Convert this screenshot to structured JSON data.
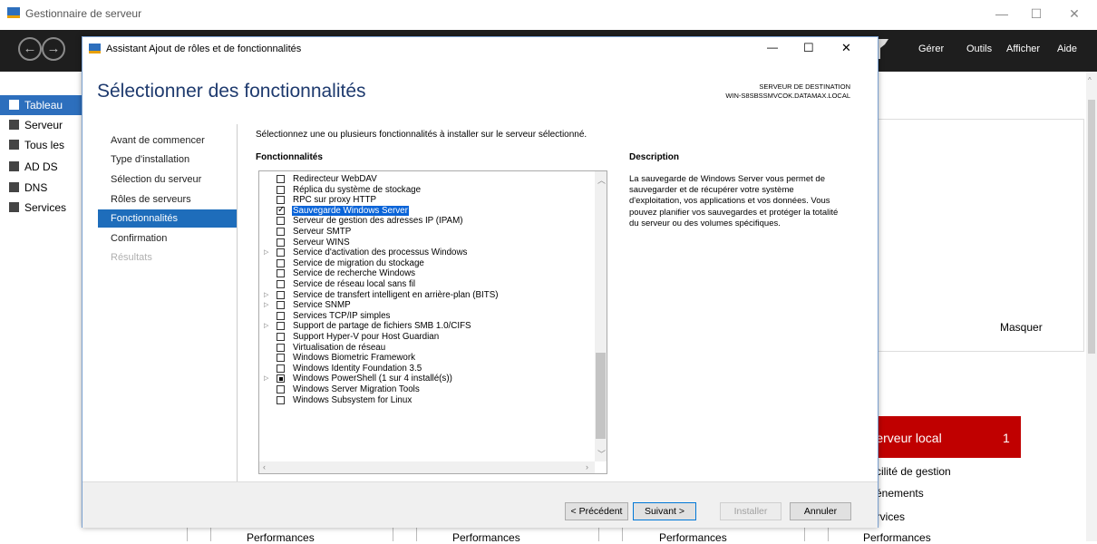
{
  "server_manager": {
    "title": "Gestionnaire de serveur",
    "menu": [
      "Gérer",
      "Outils",
      "Afficher",
      "Aide"
    ],
    "nav": [
      "Tableau",
      "Serveur",
      "Tous les",
      "AD DS",
      "DNS",
      "Services"
    ],
    "hide_label": "Masquer",
    "local_tile": {
      "label": "Serveur local",
      "count": "1",
      "color": "#c00000"
    },
    "tile_lines": [
      "Facilité de gestion",
      "Événements",
      "Services",
      "Performances"
    ],
    "perf_labels": [
      "Performances",
      "Performances",
      "Performances"
    ]
  },
  "wizard": {
    "title": "Assistant Ajout de rôles et de fonctionnalités",
    "heading": "Sélectionner des fonctionnalités",
    "destination_label": "SERVEUR DE DESTINATION",
    "destination_server": "WIN-S8SBSSMVCOK.DATAMAX.LOCAL",
    "steps": [
      {
        "label": "Avant de commencer",
        "state": "normal"
      },
      {
        "label": "Type d'installation",
        "state": "normal"
      },
      {
        "label": "Sélection du serveur",
        "state": "normal"
      },
      {
        "label": "Rôles de serveurs",
        "state": "normal"
      },
      {
        "label": "Fonctionnalités",
        "state": "active"
      },
      {
        "label": "Confirmation",
        "state": "normal"
      },
      {
        "label": "Résultats",
        "state": "disabled"
      }
    ],
    "instruction": "Sélectionnez une ou plusieurs fonctionnalités à installer sur le serveur sélectionné.",
    "features_label": "Fonctionnalités",
    "description_label": "Description",
    "description_text": "La sauvegarde de Windows Server vous permet de sauvegarder et de récupérer votre système d'exploitation, vos applications et vos données. Vous pouvez planifier vos sauvegardes et protéger la totalité du serveur ou des volumes spécifiques.",
    "features": [
      {
        "label": "Redirecteur WebDAV",
        "state": "unchecked",
        "expandable": false,
        "selected": false
      },
      {
        "label": "Réplica du système de stockage",
        "state": "unchecked",
        "expandable": false,
        "selected": false
      },
      {
        "label": "RPC sur proxy HTTP",
        "state": "unchecked",
        "expandable": false,
        "selected": false
      },
      {
        "label": "Sauvegarde Windows Server",
        "state": "checked",
        "expandable": false,
        "selected": true
      },
      {
        "label": "Serveur de gestion des adresses IP (IPAM)",
        "state": "unchecked",
        "expandable": false,
        "selected": false
      },
      {
        "label": "Serveur SMTP",
        "state": "unchecked",
        "expandable": false,
        "selected": false
      },
      {
        "label": "Serveur WINS",
        "state": "unchecked",
        "expandable": false,
        "selected": false
      },
      {
        "label": "Service d'activation des processus Windows",
        "state": "unchecked",
        "expandable": true,
        "selected": false
      },
      {
        "label": "Service de migration du stockage",
        "state": "unchecked",
        "expandable": false,
        "selected": false
      },
      {
        "label": "Service de recherche Windows",
        "state": "unchecked",
        "expandable": false,
        "selected": false
      },
      {
        "label": "Service de réseau local sans fil",
        "state": "unchecked",
        "expandable": false,
        "selected": false
      },
      {
        "label": "Service de transfert intelligent en arrière-plan (BITS)",
        "state": "unchecked",
        "expandable": true,
        "selected": false
      },
      {
        "label": "Service SNMP",
        "state": "unchecked",
        "expandable": true,
        "selected": false
      },
      {
        "label": "Services TCP/IP simples",
        "state": "unchecked",
        "expandable": false,
        "selected": false
      },
      {
        "label": "Support de partage de fichiers SMB 1.0/CIFS",
        "state": "unchecked",
        "expandable": true,
        "selected": false
      },
      {
        "label": "Support Hyper-V pour Host Guardian",
        "state": "unchecked",
        "expandable": false,
        "selected": false
      },
      {
        "label": "Virtualisation de réseau",
        "state": "unchecked",
        "expandable": false,
        "selected": false
      },
      {
        "label": "Windows Biometric Framework",
        "state": "unchecked",
        "expandable": false,
        "selected": false
      },
      {
        "label": "Windows Identity Foundation 3.5",
        "state": "unchecked",
        "expandable": false,
        "selected": false
      },
      {
        "label": "Windows PowerShell (1 sur 4 installé(s))",
        "state": "partial",
        "expandable": true,
        "selected": false
      },
      {
        "label": "Windows Server Migration Tools",
        "state": "unchecked",
        "expandable": false,
        "selected": false
      },
      {
        "label": "Windows Subsystem for Linux",
        "state": "unchecked",
        "expandable": false,
        "selected": false
      }
    ],
    "buttons": {
      "previous": "< Précédent",
      "next": "Suivant >",
      "install": "Installer",
      "cancel": "Annuler"
    }
  }
}
